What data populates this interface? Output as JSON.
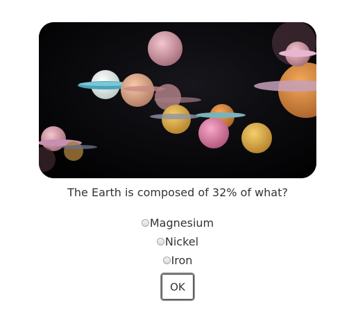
{
  "quiz": {
    "question": "The Earth is composed of 32% of what?",
    "options": [
      {
        "label": "Magnesium"
      },
      {
        "label": "Nickel"
      },
      {
        "label": "Iron"
      }
    ],
    "submit_label": "OK"
  }
}
